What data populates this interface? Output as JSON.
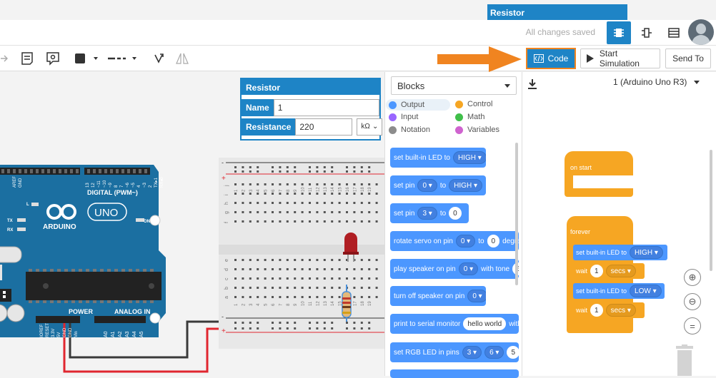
{
  "tooltip_tab": "Resistor",
  "header": {
    "status": "All changes saved"
  },
  "toolbar": {
    "code_label": "Code",
    "start_sim_label": "Start Simulation",
    "send_to_label": "Send To"
  },
  "inspector": {
    "title": "Resistor",
    "name_label": "Name",
    "name_value": "1",
    "resistance_label": "Resistance",
    "resistance_value": "220",
    "unit": "kΩ"
  },
  "code_panel": {
    "mode": "Blocks",
    "categories": [
      "Output",
      "Control",
      "Input",
      "Math",
      "Notation",
      "Variables"
    ],
    "category_colors": {
      "Output": "#4c97ff",
      "Control": "#f6a623",
      "Input": "#9966ff",
      "Math": "#40bf4a",
      "Notation": "#8c8c8c",
      "Variables": "#cf63cf"
    },
    "blocks": [
      {
        "text": "set built-in LED to",
        "arg": "HIGH ▾"
      },
      {
        "text": "set pin",
        "arg": "0 ▾",
        "text2": "to",
        "arg2": "HIGH ▾"
      },
      {
        "text": "set pin",
        "arg": "3 ▾",
        "text2": "to",
        "val": "0"
      },
      {
        "text": "rotate servo on pin",
        "arg": "0 ▾",
        "text2": "to",
        "val": "0",
        "text3": "degre"
      },
      {
        "text": "play speaker on pin",
        "arg": "0 ▾",
        "text2": "with tone",
        "val": "6"
      },
      {
        "text": "turn off speaker on pin",
        "arg": "0 ▾"
      },
      {
        "text": "print to serial monitor",
        "val": "hello world",
        "text2": "with"
      },
      {
        "text": "set RGB LED in pins",
        "arg": "3 ▾",
        "arg2": "6 ▾",
        "val": "5"
      }
    ]
  },
  "workspace": {
    "board": "1 (Arduino Uno R3)",
    "on_start": "on start",
    "forever": "forever",
    "script": [
      {
        "text": "set built-in LED to",
        "arg": "HIGH ▾"
      },
      {
        "text": "wait",
        "val": "1",
        "arg": "secs ▾"
      },
      {
        "text": "set built-in LED to",
        "arg": "LOW ▾"
      },
      {
        "text": "wait",
        "val": "1",
        "arg": "secs ▾"
      }
    ]
  },
  "arduino": {
    "digital_label": "DIGITAL (PWM~)",
    "uno_label": "UNO",
    "brand": "ARDUINO",
    "power_label": "POWER",
    "analog_label": "ANALOG IN",
    "on_label": "ON",
    "tx": "TX",
    "rx": "RX",
    "l": "L",
    "pins_top": [
      "AREF",
      "GND",
      "13",
      "12",
      "~11",
      "~10",
      "~9",
      "8",
      "7",
      "~6",
      "~5",
      "4",
      "~3",
      "2",
      "TX▸1",
      "RX◂0"
    ],
    "pins_power": [
      "IOREF",
      "RESET",
      "3.3V",
      "5V",
      "GND",
      "GND",
      "Vin"
    ],
    "pins_analog": [
      "A0",
      "A1",
      "A2",
      "A3",
      "A4",
      "A5"
    ]
  },
  "breadboard": {
    "row_letters_top": [
      "j",
      "i",
      "h",
      "g",
      "f"
    ],
    "row_letters_bottom": [
      "e",
      "d",
      "c",
      "b",
      "a"
    ],
    "col_numbers": [
      "1",
      "2",
      "3",
      "4",
      "5",
      "6",
      "7",
      "8",
      "9",
      "10",
      "11",
      "12",
      "13",
      "14",
      "15",
      "16",
      "17",
      "18",
      "19"
    ]
  },
  "colors": {
    "accent": "#1e84c6",
    "arrow": "#f08420",
    "board": "#1b6fa1",
    "wire_red": "#e0262f",
    "wire_black": "#3a3a3a"
  }
}
